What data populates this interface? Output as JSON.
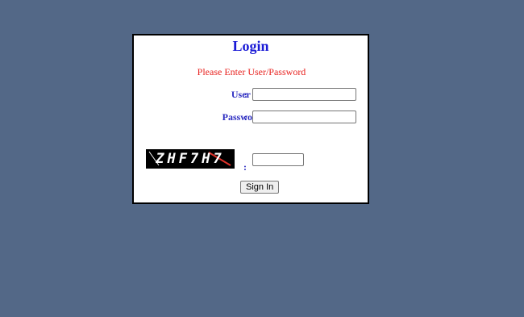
{
  "login": {
    "title": "Login",
    "message": "Please Enter User/Password",
    "user_id_label": "User Id",
    "password_label": "Password",
    "colon": ":",
    "user_id_value": "",
    "password_value": "",
    "captcha_text": "ZHF7H7",
    "captcha_value": "",
    "signin_label": "Sign In"
  },
  "colors": {
    "page_background": "#536887",
    "title": "#1a1ad6",
    "message": "#e8221f",
    "labels": "#2a2ac0"
  }
}
